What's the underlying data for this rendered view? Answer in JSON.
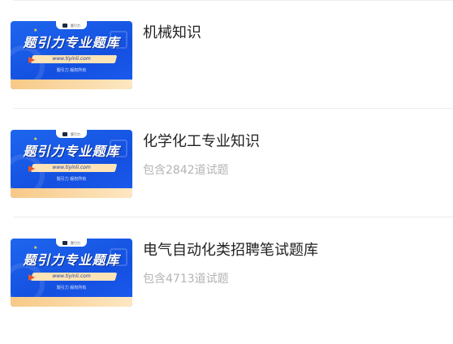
{
  "thumbnail": {
    "headline": "题引力专业题库",
    "url": "www.tiyinli.com",
    "copyright": "题引力 版权所有",
    "badge": "题引力"
  },
  "items": [
    {
      "title": "机械知识",
      "subtitle": ""
    },
    {
      "title": "化学化工专业知识",
      "subtitle": "包含2842道试题"
    },
    {
      "title": "电气自动化类招聘笔试题库",
      "subtitle": "包含4713道试题"
    }
  ],
  "colors": {
    "brand_blue": "#1e66ee",
    "accent_orange": "#f7c987",
    "text_primary": "#222222",
    "text_secondary": "#b3b3b3"
  }
}
